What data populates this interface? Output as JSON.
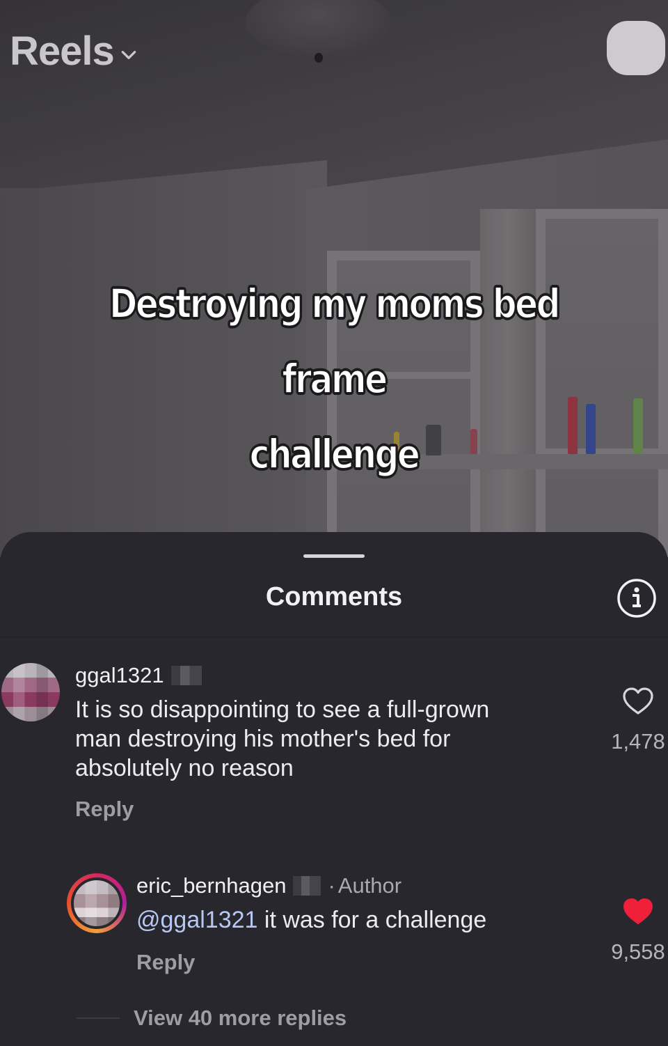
{
  "header": {
    "title": "Reels",
    "chevron_icon": "chevron-down-icon",
    "camera_icon": "camera-icon"
  },
  "video": {
    "caption_line1": "Destroying my moms bed frame",
    "caption_line2": "challenge"
  },
  "comments_sheet": {
    "title": "Comments",
    "info_icon": "info-icon",
    "comments": [
      {
        "username": "ggal1321",
        "text": "It is so disappointing to see a full-grown man destroying his mother's bed for absolutely no reason",
        "text_line1": "It is so disappointing to see a full-grown",
        "text_line2": "man destroying his mother's bed for",
        "text_line3": "absolutely no reason",
        "reply_label": "Reply",
        "like_count": "1,478",
        "liked": false
      }
    ],
    "replies": [
      {
        "username": "eric_bernhagen",
        "separator": "·",
        "badge": "Author",
        "mention": "@ggal1321",
        "text": " it was for a challenge",
        "reply_label": "Reply",
        "like_count": "9,558",
        "liked": true
      }
    ],
    "view_more_label": "View 40 more replies"
  },
  "colors": {
    "sheet_background": "#27272d",
    "like_active": "#f0203a",
    "mention": "#b8c8f4",
    "muted_text": "#9d9da4"
  }
}
